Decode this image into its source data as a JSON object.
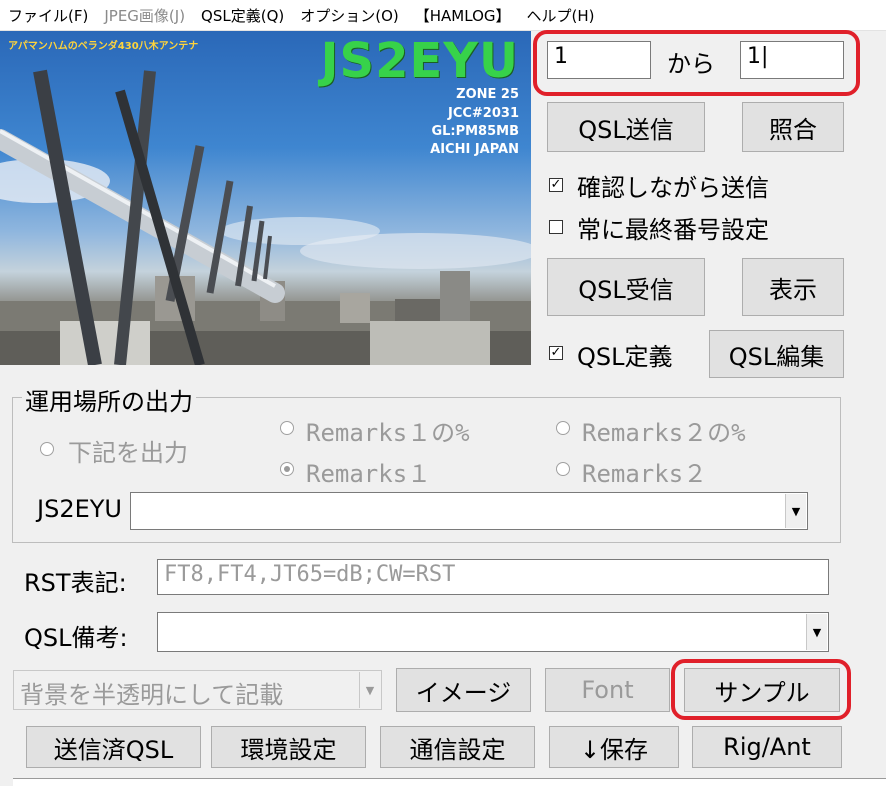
{
  "menu": [
    {
      "label": "ファイル(F)",
      "enabled": true
    },
    {
      "label": "JPEG画像(J)",
      "enabled": false
    },
    {
      "label": "QSL定義(Q)",
      "enabled": true
    },
    {
      "label": "オプション(O)",
      "enabled": true
    },
    {
      "label": "【HAMLOG】",
      "enabled": true
    },
    {
      "label": "ヘルプ(H)",
      "enabled": true
    }
  ],
  "photo": {
    "caption": "アパマンハムのベランダ430八木アンテナ",
    "callsign": "JS2EYU",
    "zone": "ZONE 25",
    "jcc": "JCC#2031",
    "grid": "GL:PM85MB",
    "location": "AICHI JAPAN"
  },
  "range": {
    "from_value": "1",
    "separator": "から",
    "to_value": "1|"
  },
  "buttons": {
    "qsl_send": "QSL送信",
    "match": "照合",
    "qsl_receive": "QSL受信",
    "display": "表示",
    "qsl_edit": "QSL編集",
    "image": "イメージ",
    "font": "Font",
    "sample": "サンプル",
    "sent_qsl": "送信済QSL",
    "env_settings": "環境設定",
    "comm_settings": "通信設定",
    "save": "↓保存",
    "rig_ant": "Rig/Ant"
  },
  "checkboxes": {
    "confirm_send": {
      "label": "確認しながら送信",
      "checked": true
    },
    "always_last": {
      "label": "常に最終番号設定",
      "checked": false
    },
    "qsl_def": {
      "label": "QSL定義",
      "checked": true
    }
  },
  "operating_place": {
    "title": "運用場所の出力",
    "radio_below": "下記を出力",
    "radio_rem1pct": "Remarks１の%",
    "radio_rem2pct": "Remarks２の%",
    "radio_rem1": "Remarks１",
    "radio_rem2": "Remarks２",
    "call_label": "JS2EYU",
    "call_value": ""
  },
  "rst": {
    "label": "RST表記:",
    "value": "FT8,FT4,JT65=dB;CW=RST"
  },
  "qsl_remarks": {
    "label": "QSL備考:",
    "value": ""
  },
  "background_mode": {
    "selected": "背景を半透明にして記載"
  },
  "check_mark": "✓",
  "arrow": "▼",
  "colors": {
    "highlight": "#e0202a",
    "callsign": "#37d24a",
    "caption": "#ffd43b"
  }
}
